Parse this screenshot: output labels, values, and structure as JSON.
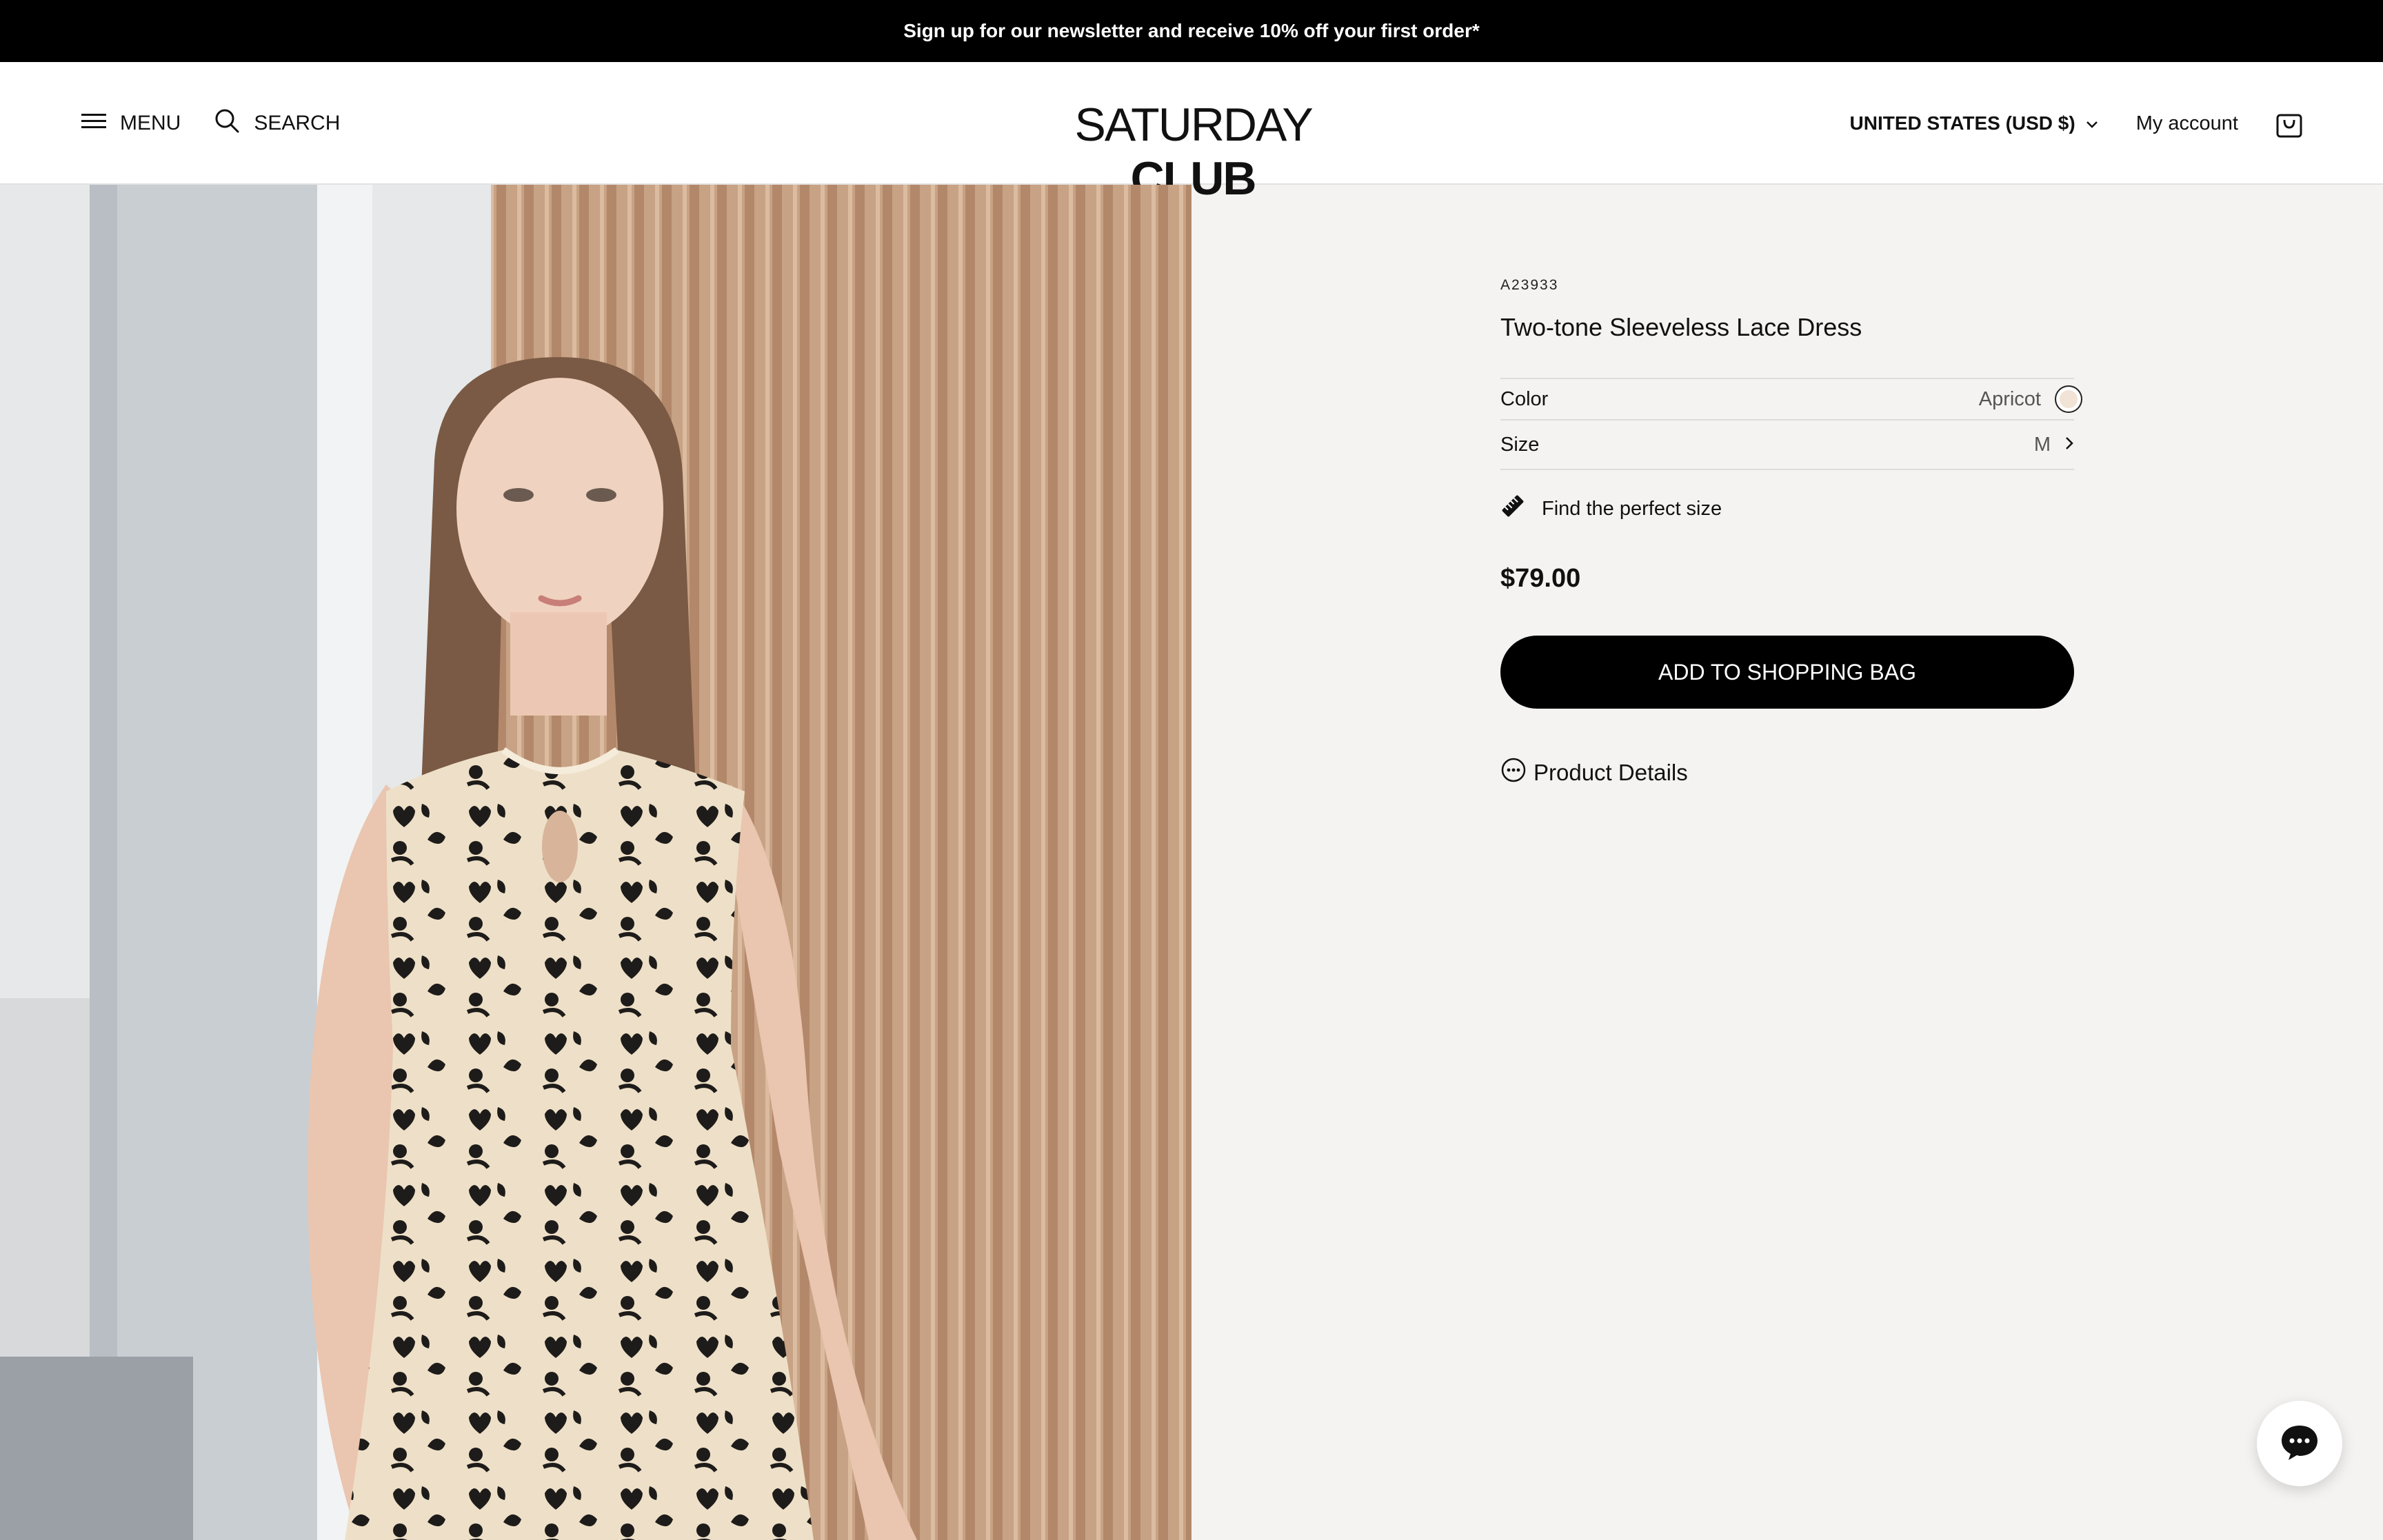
{
  "announcement": {
    "text": "Sign up for our newsletter and receive 10% off your first order*"
  },
  "header": {
    "menu_label": "MENU",
    "search_label": "SEARCH",
    "logo_part1": "SATURDAY",
    "logo_part2": "CLUB",
    "currency": "UNITED STATES (USD $)",
    "account": "My account"
  },
  "product": {
    "sku": "A23933",
    "title": "Two-tone Sleeveless Lace Dress",
    "color_label": "Color",
    "color_value": "Apricot",
    "swatch_color": "#f1e3d6",
    "size_label": "Size",
    "size_value": "M",
    "fit_label": "Find the perfect size",
    "price": "$79.00",
    "add_to_bag": "ADD TO SHOPPING BAG",
    "details_label": "Product Details"
  },
  "icons": {
    "menu": "hamburger-icon",
    "search": "search-icon",
    "currency": "chevron-down-icon",
    "bag": "shopping-bag-icon",
    "size": "chevron-right-icon",
    "fit": "ruler-icon",
    "details": "ellipsis-circle-icon",
    "chat": "chat-icon"
  }
}
